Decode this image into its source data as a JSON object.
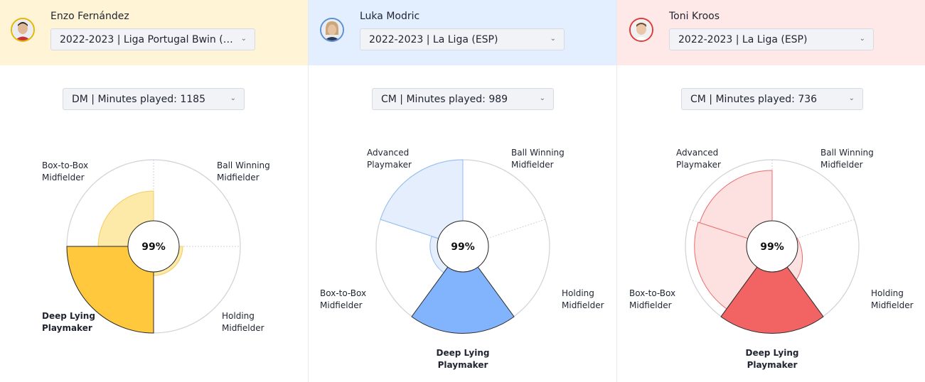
{
  "players": [
    {
      "name": "Enzo Fernández",
      "season": "2022-2023 | Liga Portugal Bwin (P...",
      "position": "DM | Minutes played: 1185",
      "header_bg": "#fff5d6",
      "accent": "#ffc83d",
      "accent_light": "#fde9a8",
      "border": "#e6b700",
      "avatar_icon": "player-photo-icon",
      "center_value": "99%",
      "labels": {
        "top_left": [
          "Box-to-Box",
          "Midfielder"
        ],
        "top_right": [
          "Ball Winning",
          "Midfielder"
        ],
        "bottom_left": [
          "Deep Lying",
          "Playmaker"
        ],
        "bottom_right": [
          "Holding",
          "Midfielder"
        ]
      }
    },
    {
      "name": "Luka Modric",
      "season": "2022-2023 | La Liga (ESP)",
      "position": "CM | Minutes played: 989",
      "header_bg": "#e3efff",
      "accent": "#82b4fd",
      "accent_light": "#e4eefd",
      "border": "#5b8fd6",
      "avatar_icon": "player-photo-icon",
      "center_value": "99%",
      "labels": {
        "top_left": [
          "Advanced",
          "Playmaker"
        ],
        "top_right": [
          "Ball Winning",
          "Midfielder"
        ],
        "bottom_left": [
          "Box-to-Box",
          "Midfielder"
        ],
        "bottom_right": [
          "Holding",
          "Midfielder"
        ],
        "bottom": [
          "Deep Lying",
          "Playmaker"
        ]
      }
    },
    {
      "name": "Toni Kroos",
      "season": "2022-2023 | La Liga (ESP)",
      "position": "CM | Minutes played: 736",
      "header_bg": "#ffe8e8",
      "accent": "#f26464",
      "accent_light": "#fde0e0",
      "border": "#e03a3a",
      "avatar_icon": "player-photo-icon",
      "center_value": "99%",
      "labels": {
        "top_left": [
          "Advanced",
          "Playmaker"
        ],
        "top_right": [
          "Ball Winning",
          "Midfielder"
        ],
        "bottom_left": [
          "Box-to-Box",
          "Midfielder"
        ],
        "bottom_right": [
          "Holding",
          "Midfielder"
        ],
        "bottom": [
          "Deep Lying",
          "Playmaker"
        ]
      }
    }
  ]
}
